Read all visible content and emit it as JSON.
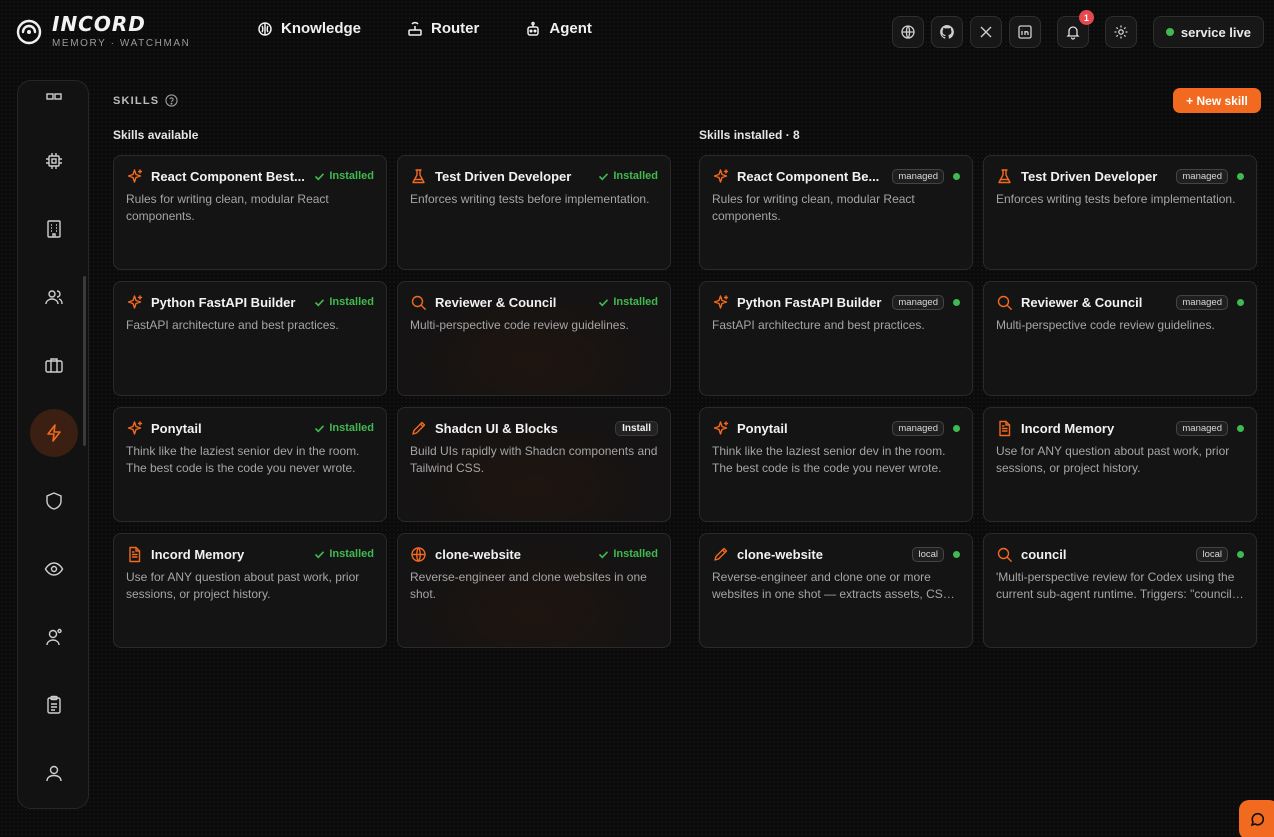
{
  "brand": {
    "name": "INCORD",
    "subtitle": "MEMORY · WATCHMAN"
  },
  "nav": [
    {
      "label": "Knowledge",
      "icon": "brain-icon"
    },
    {
      "label": "Router",
      "icon": "router-icon"
    },
    {
      "label": "Agent",
      "icon": "bot-icon"
    }
  ],
  "topbar": {
    "icons": [
      "globe-icon",
      "github-icon",
      "x-icon",
      "linkedin-icon"
    ],
    "notifications": "1",
    "status_label": "service live"
  },
  "sidebar": {
    "items": [
      "grid-icon",
      "cpu-icon",
      "building-icon",
      "users-icon",
      "briefcase-icon",
      "zap-icon",
      "shield-icon",
      "eye-icon",
      "user-cog-icon",
      "clipboard-icon",
      "user-icon"
    ],
    "active": "zap-icon"
  },
  "page": {
    "section_title": "SKILLS",
    "new_skill_label": "+ New skill",
    "available_title": "Skills available",
    "installed_title": "Skills installed · 8"
  },
  "colors": {
    "accent": "#f26a1f",
    "success": "#3fb950",
    "badge": "#e5484d"
  },
  "available": [
    {
      "title": "React Component Best...",
      "desc": "Rules for writing clean, modular React components.",
      "icon": "sparkles-icon",
      "status": "Installed"
    },
    {
      "title": "Test Driven Developer",
      "desc": "Enforces writing tests before implementation.",
      "icon": "flask-icon",
      "status": "Installed"
    },
    {
      "title": "Python FastAPI Builder",
      "desc": "FastAPI architecture and best practices.",
      "icon": "sparkles-icon",
      "status": "Installed"
    },
    {
      "title": "Reviewer & Council",
      "desc": "Multi-perspective code review guidelines.",
      "icon": "search-icon",
      "status": "Installed"
    },
    {
      "title": "Ponytail",
      "desc": "Think like the laziest senior dev in the room. The best code is the code you never wrote.",
      "icon": "sparkles-icon",
      "status": "Installed"
    },
    {
      "title": "Shadcn UI & Blocks",
      "desc": "Build UIs rapidly with Shadcn components and Tailwind CSS.",
      "icon": "pencil-icon",
      "status": "Install"
    },
    {
      "title": "Incord Memory",
      "desc": "Use for ANY question about past work, prior sessions, or project history.",
      "icon": "file-text-icon",
      "status": "Installed"
    },
    {
      "title": "clone-website",
      "desc": "Reverse-engineer and clone websites in one shot.",
      "icon": "globe-icon",
      "status": "Installed"
    }
  ],
  "installed": [
    {
      "title": "React Component Be...",
      "desc": "Rules for writing clean, modular React components.",
      "icon": "sparkles-icon",
      "tag": "managed"
    },
    {
      "title": "Test Driven Developer",
      "desc": "Enforces writing tests before implementation.",
      "icon": "flask-icon",
      "tag": "managed"
    },
    {
      "title": "Python FastAPI Builder",
      "desc": "FastAPI architecture and best practices.",
      "icon": "sparkles-icon",
      "tag": "managed"
    },
    {
      "title": "Reviewer & Council",
      "desc": "Multi-perspective code review guidelines.",
      "icon": "search-icon",
      "tag": "managed"
    },
    {
      "title": "Ponytail",
      "desc": "Think like the laziest senior dev in the room. The best code is the code you never wrote.",
      "icon": "sparkles-icon",
      "tag": "managed"
    },
    {
      "title": "Incord Memory",
      "desc": "Use for ANY question about past work, prior sessions, or project history.",
      "icon": "file-text-icon",
      "tag": "managed"
    },
    {
      "title": "clone-website",
      "desc": "Reverse-engineer and clone one or more websites in one shot — extracts assets, CSS, and content.",
      "icon": "pencil-icon",
      "tag": "local"
    },
    {
      "title": "council",
      "desc": "'Multi-perspective review for Codex using the current sub-agent runtime. Triggers: \"council\", \"review\".",
      "icon": "search-icon",
      "tag": "local"
    }
  ]
}
